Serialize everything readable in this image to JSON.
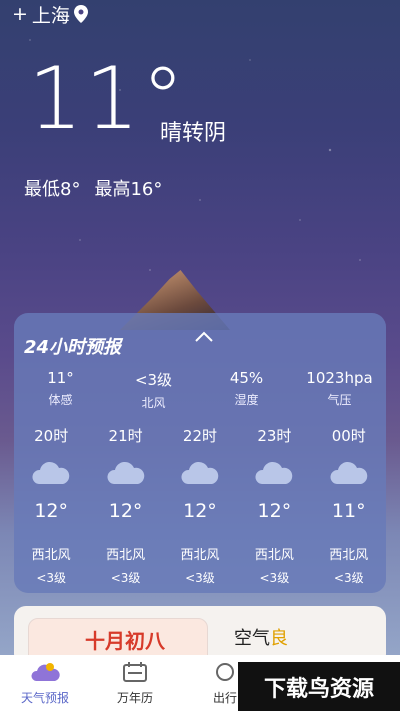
{
  "location": {
    "city": "上海"
  },
  "current": {
    "temp": "11°",
    "condition": "晴转阴",
    "low": "最低8°",
    "high": "最高16°"
  },
  "forecast": {
    "title": "24小时预报",
    "stats": [
      {
        "value": "11°",
        "label": "体感"
      },
      {
        "value": "<3级",
        "label": "北风"
      },
      {
        "value": "45%",
        "label": "湿度"
      },
      {
        "value": "1023hpa",
        "label": "气压"
      }
    ],
    "hours": [
      {
        "time": "20时",
        "temp": "12°",
        "wind_dir": "西北风",
        "wind_level": "<3级"
      },
      {
        "time": "21时",
        "temp": "12°",
        "wind_dir": "西北风",
        "wind_level": "<3级"
      },
      {
        "time": "22时",
        "temp": "12°",
        "wind_dir": "西北风",
        "wind_level": "<3级"
      },
      {
        "time": "23时",
        "temp": "12°",
        "wind_dir": "西北风",
        "wind_level": "<3级"
      },
      {
        "time": "00时",
        "temp": "11°",
        "wind_dir": "西北风",
        "wind_level": "<3级"
      }
    ]
  },
  "calendar_card": {
    "text": "十月初八"
  },
  "air_quality": {
    "label": "空气",
    "level": "良"
  },
  "tabs": [
    {
      "label": "天气预报",
      "icon": "weather-icon",
      "active": true
    },
    {
      "label": "万年历",
      "icon": "calendar-icon",
      "active": false
    },
    {
      "label": "出行",
      "icon": "travel-icon",
      "active": false
    }
  ],
  "watermark": "下载鸟资源",
  "colors": {
    "accent": "#5a67c8",
    "card_bg": "#687ab8",
    "air_good": "#e0a000",
    "calendar_red": "#d73a2a"
  }
}
